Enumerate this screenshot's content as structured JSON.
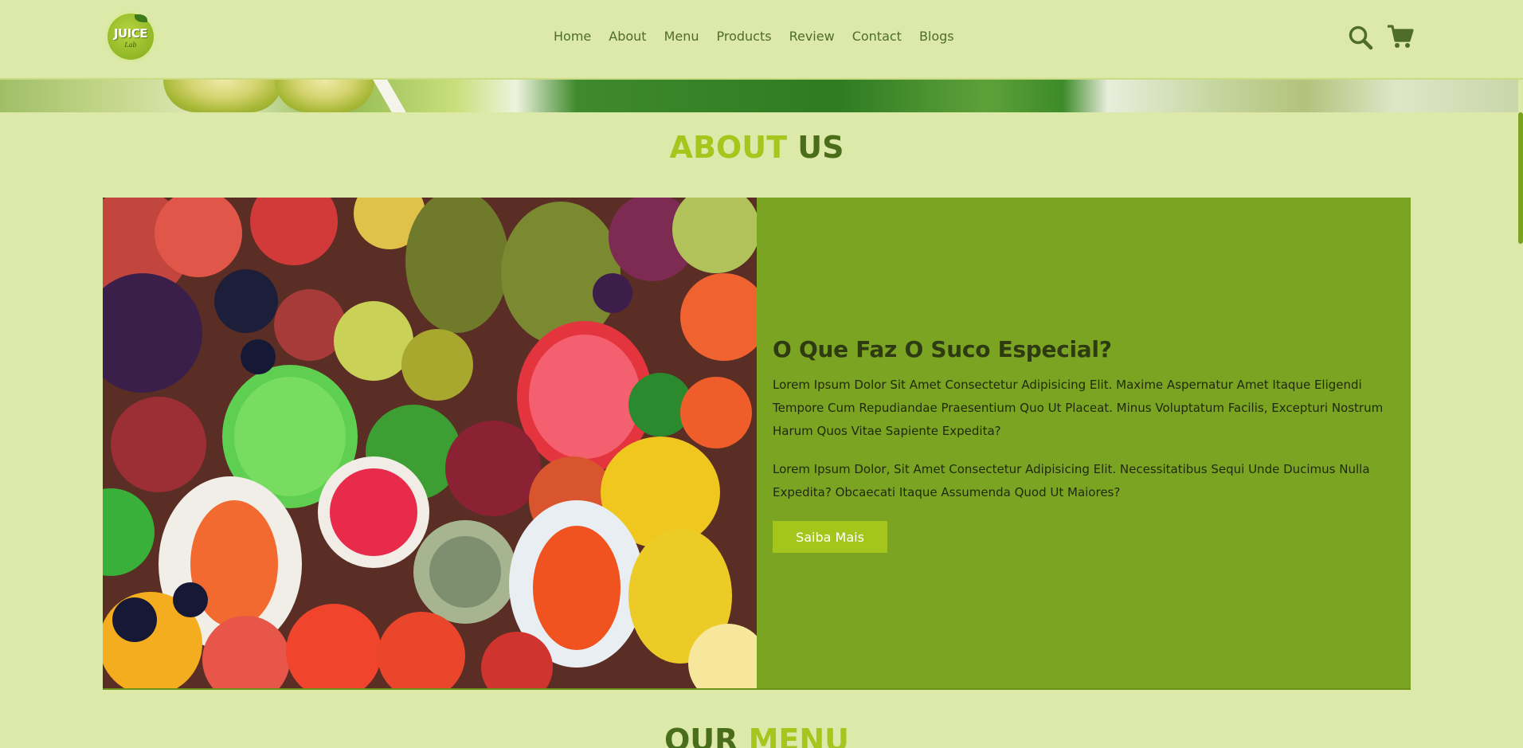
{
  "header": {
    "logo": {
      "main": "JUICE",
      "sub": "Lab"
    },
    "nav": [
      "Home",
      "About",
      "Menu",
      "Products",
      "Review",
      "Contact",
      "Blogs"
    ],
    "icons": {
      "search": "search-icon",
      "cart": "cart-icon"
    }
  },
  "about": {
    "title_light": "ABOUT",
    "title_dark": "US",
    "heading": "O Que Faz O Suco Especial?",
    "paragraph1": "Lorem Ipsum Dolor Sit Amet Consectetur Adipisicing Elit. Maxime Aspernatur Amet Itaque Eligendi Tempore Cum Repudiandae Praesentium Quo Ut Placeat. Minus Voluptatum Facilis, Excepturi Nostrum Harum Quos Vitae Sapiente Expedita?",
    "paragraph2": "Lorem Ipsum Dolor, Sit Amet Consectetur Adipisicing Elit. Necessitatibus Sequi Unde Ducimus Nulla Expedita? Obcaecati Itaque Assumenda Quod Ut Maiores?",
    "button": "Saiba Mais"
  },
  "next_section": {
    "title_dark": "OUR",
    "title_light": "MENU"
  },
  "colors": {
    "background": "#dde9a8",
    "accent_light": "#a8c51e",
    "accent_dark": "#4a6d1c",
    "panel": "#7aa422"
  }
}
